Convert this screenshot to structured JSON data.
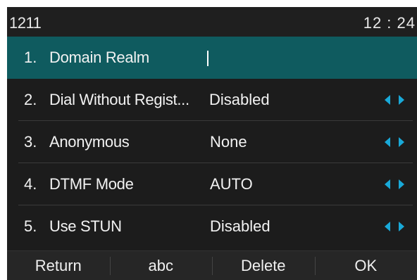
{
  "status_bar": {
    "account": "1211",
    "time": "12 : 24"
  },
  "list": {
    "items": [
      {
        "number": "1.",
        "label": "Domain Realm",
        "value": "",
        "selected": true,
        "has_arrows": false
      },
      {
        "number": "2.",
        "label": "Dial Without Regist...",
        "value": "Disabled",
        "selected": false,
        "has_arrows": true
      },
      {
        "number": "3.",
        "label": "Anonymous",
        "value": "None",
        "selected": false,
        "has_arrows": true
      },
      {
        "number": "4.",
        "label": "DTMF Mode",
        "value": "AUTO",
        "selected": false,
        "has_arrows": true
      },
      {
        "number": "5.",
        "label": "Use STUN",
        "value": "Disabled",
        "selected": false,
        "has_arrows": true
      }
    ]
  },
  "softkeys": {
    "return_label": "Return",
    "input_mode_label": "abc",
    "delete_label": "Delete",
    "ok_label": "OK"
  },
  "colors": {
    "background": "#1c1c1c",
    "selected_row": "#0f5b5f",
    "arrow_accent": "#19a9d8",
    "text": "#f2f2f2"
  },
  "icons": {
    "arrow_left": "chevron-left-icon",
    "arrow_right": "chevron-right-icon"
  }
}
